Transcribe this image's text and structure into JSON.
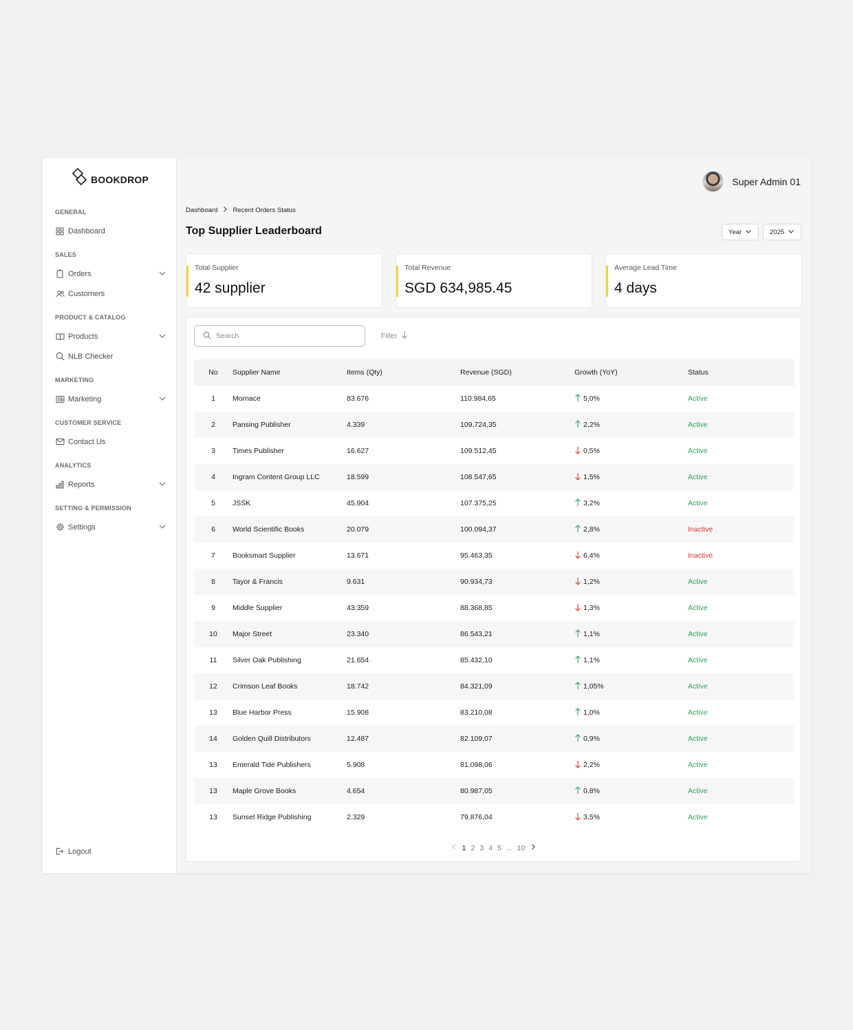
{
  "brand": {
    "name": "BOOKDROP"
  },
  "user": {
    "name": "Super Admin 01"
  },
  "sidebar": {
    "sections": [
      {
        "heading": "GENERAL",
        "items": [
          {
            "label": "Dashboard",
            "icon": "grid-icon",
            "expandable": false
          }
        ]
      },
      {
        "heading": "SALES",
        "items": [
          {
            "label": "Orders",
            "icon": "clipboard-icon",
            "expandable": true
          },
          {
            "label": "Customers",
            "icon": "users-icon",
            "expandable": false
          }
        ]
      },
      {
        "heading": "PRODUCT & CATALOG",
        "items": [
          {
            "label": "Products",
            "icon": "book-icon",
            "expandable": true
          },
          {
            "label": "NLB Checker",
            "icon": "search-icon",
            "expandable": false
          }
        ]
      },
      {
        "heading": "MARKETING",
        "items": [
          {
            "label": "Marketing",
            "icon": "newspaper-icon",
            "expandable": true
          }
        ]
      },
      {
        "heading": "CUSTOMER SERVICE",
        "items": [
          {
            "label": "Contact Us",
            "icon": "mail-icon",
            "expandable": false
          }
        ]
      },
      {
        "heading": "ANALYTICS",
        "items": [
          {
            "label": "Reports",
            "icon": "bar-chart-icon",
            "expandable": true
          }
        ]
      },
      {
        "heading": "SETTING & PERMISSION",
        "items": [
          {
            "label": "Settings",
            "icon": "gear-icon",
            "expandable": true
          }
        ]
      }
    ],
    "logout_label": "Logout"
  },
  "breadcrumb": {
    "items": [
      "Dashboard",
      "Recent Orders Status"
    ]
  },
  "page": {
    "title": "Top Supplier Leaderboard"
  },
  "filters": {
    "period_label": "Year",
    "year_value": "2025"
  },
  "stats": [
    {
      "label": "Total Supplier",
      "value": "42 supplier"
    },
    {
      "label": "Total Revenue",
      "value": "SGD 634,985.45"
    },
    {
      "label": "Average Lead Time",
      "value": "4 days"
    }
  ],
  "colors": {
    "accent": "#f2d338",
    "active": "#2e9e5b",
    "inactive": "#d9352b"
  },
  "search": {
    "placeholder": "Search"
  },
  "filter_label": "Filter",
  "table": {
    "headers": [
      "No",
      "Supplier Name",
      "Items (Qty)",
      "Revenue (SGD)",
      "Growth (YoY)",
      "Status"
    ],
    "rows": [
      {
        "no": "1",
        "name": "Mornace",
        "items": "83.676",
        "revenue": "110.984,65",
        "growth": "5,0%",
        "trend": "up",
        "status": "Active"
      },
      {
        "no": "2",
        "name": "Pansing Publisher",
        "items": "4.339",
        "revenue": "109.724,35",
        "growth": "2,2%",
        "trend": "up",
        "status": "Active"
      },
      {
        "no": "3",
        "name": "Times Publisher",
        "items": "16.627",
        "revenue": "109.512,45",
        "growth": "0,5%",
        "trend": "down",
        "status": "Active"
      },
      {
        "no": "4",
        "name": "Ingram Content Group LLC",
        "items": "18.599",
        "revenue": "108.547,65",
        "growth": "1,5%",
        "trend": "down",
        "status": "Active"
      },
      {
        "no": "5",
        "name": "JSSK",
        "items": "45.904",
        "revenue": "107.375,25",
        "growth": "3,2%",
        "trend": "up",
        "status": "Active"
      },
      {
        "no": "6",
        "name": "World Scientific Books",
        "items": "20.079",
        "revenue": "100.094,37",
        "growth": "2,8%",
        "trend": "up",
        "status": "Inactive"
      },
      {
        "no": "7",
        "name": "Booksmart Supplier",
        "items": "13.671",
        "revenue": "95.463,35",
        "growth": "6,4%",
        "trend": "down",
        "status": "Inactive"
      },
      {
        "no": "8",
        "name": "Tayor & Francis",
        "items": "9.631",
        "revenue": "90.934,73",
        "growth": "1,2%",
        "trend": "down",
        "status": "Active"
      },
      {
        "no": "9",
        "name": "Middle Supplier",
        "items": "43.359",
        "revenue": "88.368,85",
        "growth": "1,3%",
        "trend": "down",
        "status": "Active"
      },
      {
        "no": "10",
        "name": "Major Street",
        "items": "23.340",
        "revenue": "86.543,21",
        "growth": "1,1%",
        "trend": "up",
        "status": "Active"
      },
      {
        "no": "11",
        "name": "Silver Oak Publishing",
        "items": "21.654",
        "revenue": "85.432,10",
        "growth": "1,1%",
        "trend": "up",
        "status": "Active"
      },
      {
        "no": "12",
        "name": "Crimson Leaf Books",
        "items": "18.742",
        "revenue": "84.321,09",
        "growth": "1,05%",
        "trend": "up",
        "status": "Active"
      },
      {
        "no": "13",
        "name": "Blue Harbor Press",
        "items": "15.908",
        "revenue": "83.210,08",
        "growth": "1,0%",
        "trend": "up",
        "status": "Active"
      },
      {
        "no": "14",
        "name": "Golden Quill Distributors",
        "items": "12.487",
        "revenue": "82.109,07",
        "growth": "0,9%",
        "trend": "up",
        "status": "Active"
      },
      {
        "no": "13",
        "name": "Emerald Tide Publishers",
        "items": "5.908",
        "revenue": "81.098,06",
        "growth": "2,2%",
        "trend": "down",
        "status": "Active"
      },
      {
        "no": "13",
        "name": "Maple Grove Books",
        "items": "4.654",
        "revenue": "80.987,05",
        "growth": "0,8%",
        "trend": "up",
        "status": "Active"
      },
      {
        "no": "13",
        "name": "Sunset Ridge Publishing",
        "items": "2.329",
        "revenue": "79.876,04",
        "growth": "3,5%",
        "trend": "down",
        "status": "Active"
      }
    ]
  },
  "pagination": {
    "pages": [
      "1",
      "2",
      "3",
      "4",
      "5",
      "...",
      "10"
    ],
    "current": "1"
  }
}
